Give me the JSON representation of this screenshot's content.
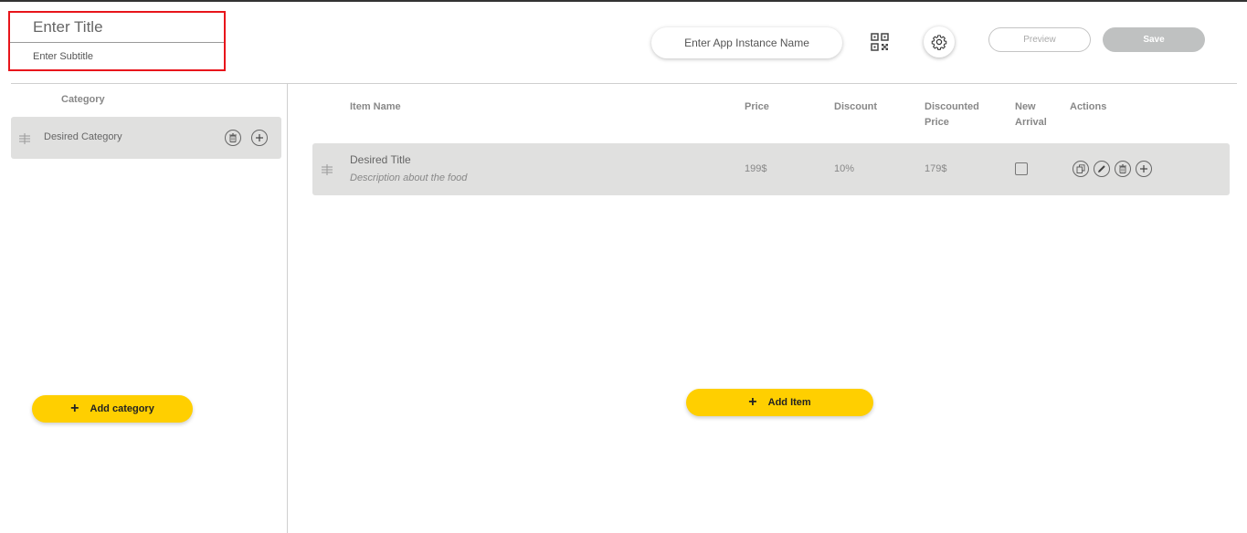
{
  "header": {
    "title_placeholder": "Enter Title",
    "subtitle_placeholder": "Enter Subtitle",
    "app_instance_placeholder": "Enter App Instance Name",
    "preview_label": "Preview",
    "save_label": "Save"
  },
  "category_panel": {
    "header": "Category",
    "categories": [
      {
        "label": "Desired Category"
      }
    ],
    "add_label": "Add category"
  },
  "items_panel": {
    "columns": {
      "item_name": "Item Name",
      "price": "Price",
      "discount": "Discount",
      "discounted_price_line1": "Discounted",
      "discounted_price_line2": "Price",
      "new_arrival_line1": "New",
      "new_arrival_line2": "Arrival",
      "actions": "Actions"
    },
    "items": [
      {
        "title": "Desired Title",
        "description": "Description about the food",
        "price": "199$",
        "discount": "10%",
        "discounted_price": "179$",
        "new_arrival": false
      }
    ],
    "add_label": "Add Item"
  },
  "icons": {
    "qr": "qr-code-icon",
    "settings": "gear-icon",
    "drag": "drag-handle-icon",
    "delete": "trash-icon",
    "add": "plus-icon",
    "copy": "copy-icon",
    "edit": "pencil-icon"
  },
  "colors": {
    "accent": "#ffcf00",
    "highlight_border": "#e8151b",
    "row_bg": "#e0e0df",
    "save_disabled": "#bfc1c1"
  }
}
